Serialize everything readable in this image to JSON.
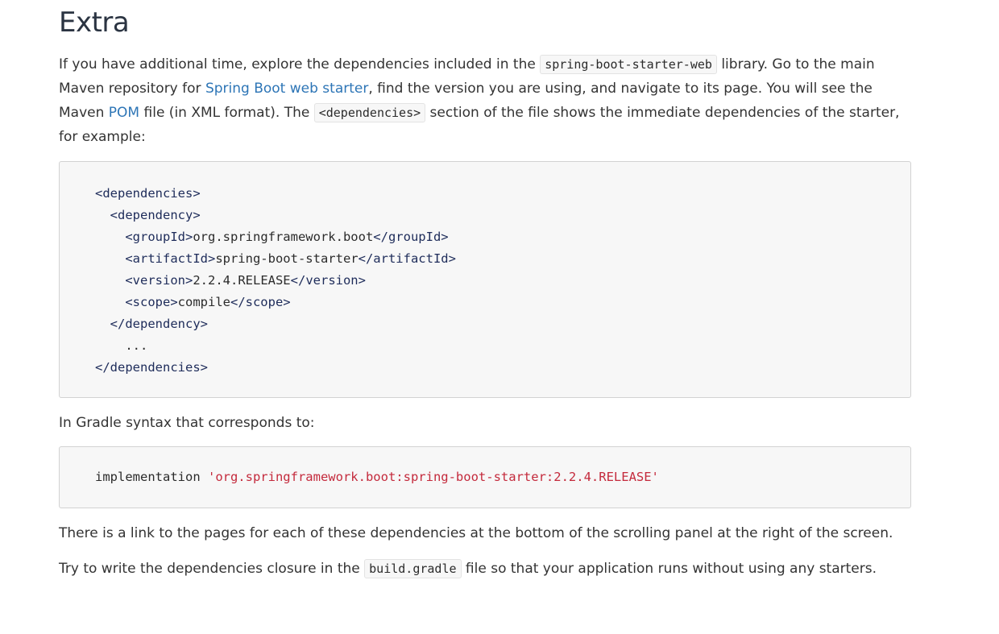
{
  "heading": "Extra",
  "para1": {
    "t1": "If you have additional time, explore the dependencies included in the ",
    "code1": "spring-boot-starter-web",
    "t2": " library. Go to the main Maven repository for ",
    "link1": "Spring Boot web starter",
    "t3": ", find the version you are using, and navigate to its page. You will see the Maven ",
    "link2": "POM",
    "t4": " file (in XML format). The ",
    "code2": "<dependencies>",
    "t5": " section of the file shows the immediate dependencies of the starter, for example:"
  },
  "xml_code": [
    {
      "indent": "",
      "parts": [
        {
          "cls": "tag",
          "v": "<dependencies>"
        }
      ]
    },
    {
      "indent": "  ",
      "parts": [
        {
          "cls": "tag",
          "v": "<dependency>"
        }
      ]
    },
    {
      "indent": "    ",
      "parts": [
        {
          "cls": "tag",
          "v": "<groupId>"
        },
        {
          "cls": "text",
          "v": "org.springframework.boot"
        },
        {
          "cls": "tag",
          "v": "</groupId>"
        }
      ]
    },
    {
      "indent": "    ",
      "parts": [
        {
          "cls": "tag",
          "v": "<artifactId>"
        },
        {
          "cls": "text",
          "v": "spring-boot-starter"
        },
        {
          "cls": "tag",
          "v": "</artifactId>"
        }
      ]
    },
    {
      "indent": "    ",
      "parts": [
        {
          "cls": "tag",
          "v": "<version>"
        },
        {
          "cls": "text",
          "v": "2.2.4.RELEASE"
        },
        {
          "cls": "tag",
          "v": "</version>"
        }
      ]
    },
    {
      "indent": "    ",
      "parts": [
        {
          "cls": "tag",
          "v": "<scope>"
        },
        {
          "cls": "text",
          "v": "compile"
        },
        {
          "cls": "tag",
          "v": "</scope>"
        }
      ]
    },
    {
      "indent": "  ",
      "parts": [
        {
          "cls": "tag",
          "v": "</dependency>"
        }
      ]
    },
    {
      "indent": "    ",
      "parts": [
        {
          "cls": "text",
          "v": "..."
        }
      ]
    },
    {
      "indent": "",
      "parts": [
        {
          "cls": "tag",
          "v": "</dependencies>"
        }
      ]
    }
  ],
  "para2": "In Gradle syntax that corresponds to:",
  "gradle_code": {
    "keyword": "implementation ",
    "string": "'org.springframework.boot:spring-boot-starter:2.2.4.RELEASE'"
  },
  "para3": "There is a link to the pages for each of these dependencies at the bottom of the scrolling panel at the right of the screen.",
  "para4": {
    "t1": "Try to write the dependencies closure in the ",
    "code": "build.gradle",
    "t2": " file so that your application runs without using any starters."
  }
}
